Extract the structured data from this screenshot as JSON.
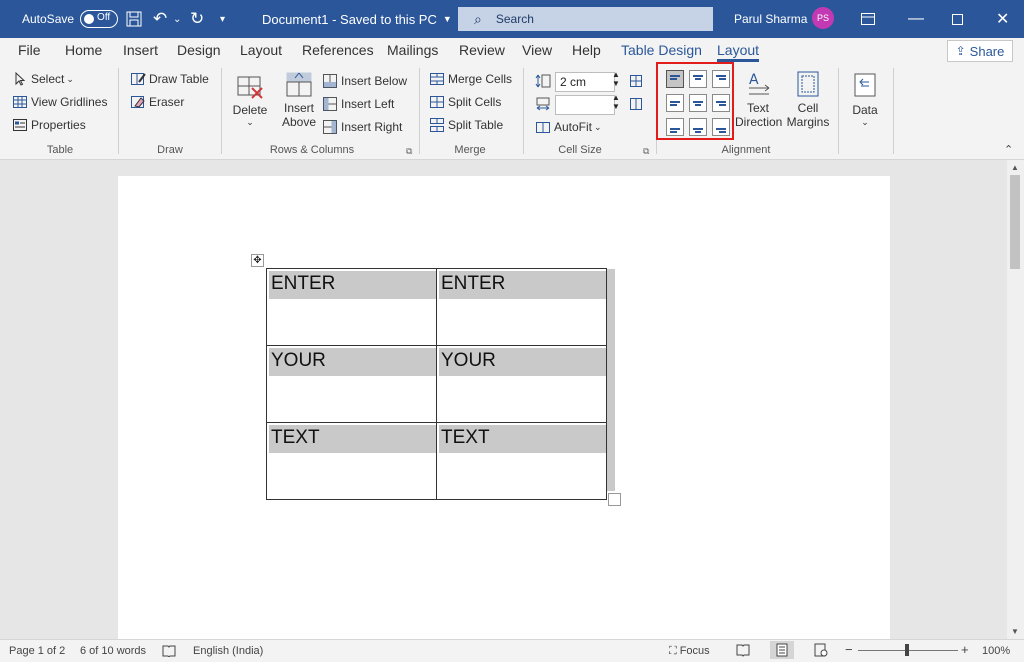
{
  "titlebar": {
    "autosave_label": "AutoSave",
    "autosave_state": "Off",
    "document_title": "Document1 - Saved to this PC",
    "search_placeholder": "Search",
    "user_name": "Parul Sharma",
    "user_initials": "PS"
  },
  "tabs": [
    "File",
    "Home",
    "Insert",
    "Design",
    "Layout",
    "References",
    "Mailings",
    "Review",
    "View",
    "Help",
    "Table Design",
    "Layout"
  ],
  "share_label": "Share",
  "ribbon": {
    "table": {
      "select": "Select",
      "gridlines": "View Gridlines",
      "properties": "Properties",
      "label": "Table"
    },
    "draw": {
      "draw_table": "Draw Table",
      "eraser": "Eraser",
      "label": "Draw"
    },
    "rows_cols": {
      "delete": "Delete",
      "insert_above_1": "Insert",
      "insert_above_2": "Above",
      "insert_below": "Insert Below",
      "insert_left": "Insert Left",
      "insert_right": "Insert Right",
      "label": "Rows & Columns"
    },
    "merge": {
      "merge_cells": "Merge Cells",
      "split_cells": "Split Cells",
      "split_table": "Split Table",
      "label": "Merge"
    },
    "cell_size": {
      "height": "2 cm",
      "width": "",
      "autofit": "AutoFit",
      "label": "Cell Size"
    },
    "alignment": {
      "text_dir_1": "Text",
      "text_dir_2": "Direction",
      "margins_1": "Cell",
      "margins_2": "Margins",
      "label": "Alignment"
    },
    "data": {
      "label": "Data"
    }
  },
  "document": {
    "rows": [
      [
        "ENTER",
        "ENTER"
      ],
      [
        "YOUR",
        "YOUR"
      ],
      [
        "TEXT",
        "TEXT"
      ]
    ]
  },
  "status": {
    "page": "Page 1 of 2",
    "words": "6 of 10 words",
    "language": "English (India)",
    "focus": "Focus",
    "zoom": "100%"
  },
  "colors": {
    "brand": "#2b579a",
    "highlight": "#e21b1b",
    "avatar": "#c239b3"
  }
}
